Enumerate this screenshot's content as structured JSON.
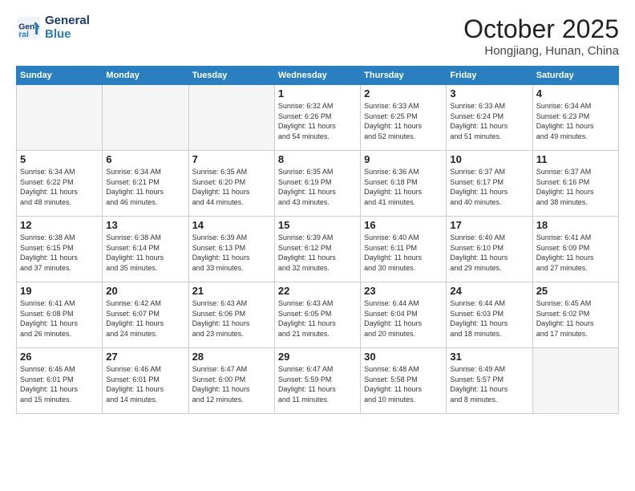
{
  "header": {
    "logo_line1": "General",
    "logo_line2": "Blue",
    "month": "October 2025",
    "location": "Hongjiang, Hunan, China"
  },
  "days_of_week": [
    "Sunday",
    "Monday",
    "Tuesday",
    "Wednesday",
    "Thursday",
    "Friday",
    "Saturday"
  ],
  "weeks": [
    [
      {
        "day": "",
        "info": ""
      },
      {
        "day": "",
        "info": ""
      },
      {
        "day": "",
        "info": ""
      },
      {
        "day": "1",
        "info": "Sunrise: 6:32 AM\nSunset: 6:26 PM\nDaylight: 11 hours\nand 54 minutes."
      },
      {
        "day": "2",
        "info": "Sunrise: 6:33 AM\nSunset: 6:25 PM\nDaylight: 11 hours\nand 52 minutes."
      },
      {
        "day": "3",
        "info": "Sunrise: 6:33 AM\nSunset: 6:24 PM\nDaylight: 11 hours\nand 51 minutes."
      },
      {
        "day": "4",
        "info": "Sunrise: 6:34 AM\nSunset: 6:23 PM\nDaylight: 11 hours\nand 49 minutes."
      }
    ],
    [
      {
        "day": "5",
        "info": "Sunrise: 6:34 AM\nSunset: 6:22 PM\nDaylight: 11 hours\nand 48 minutes."
      },
      {
        "day": "6",
        "info": "Sunrise: 6:34 AM\nSunset: 6:21 PM\nDaylight: 11 hours\nand 46 minutes."
      },
      {
        "day": "7",
        "info": "Sunrise: 6:35 AM\nSunset: 6:20 PM\nDaylight: 11 hours\nand 44 minutes."
      },
      {
        "day": "8",
        "info": "Sunrise: 6:35 AM\nSunset: 6:19 PM\nDaylight: 11 hours\nand 43 minutes."
      },
      {
        "day": "9",
        "info": "Sunrise: 6:36 AM\nSunset: 6:18 PM\nDaylight: 11 hours\nand 41 minutes."
      },
      {
        "day": "10",
        "info": "Sunrise: 6:37 AM\nSunset: 6:17 PM\nDaylight: 11 hours\nand 40 minutes."
      },
      {
        "day": "11",
        "info": "Sunrise: 6:37 AM\nSunset: 6:16 PM\nDaylight: 11 hours\nand 38 minutes."
      }
    ],
    [
      {
        "day": "12",
        "info": "Sunrise: 6:38 AM\nSunset: 6:15 PM\nDaylight: 11 hours\nand 37 minutes."
      },
      {
        "day": "13",
        "info": "Sunrise: 6:38 AM\nSunset: 6:14 PM\nDaylight: 11 hours\nand 35 minutes."
      },
      {
        "day": "14",
        "info": "Sunrise: 6:39 AM\nSunset: 6:13 PM\nDaylight: 11 hours\nand 33 minutes."
      },
      {
        "day": "15",
        "info": "Sunrise: 6:39 AM\nSunset: 6:12 PM\nDaylight: 11 hours\nand 32 minutes."
      },
      {
        "day": "16",
        "info": "Sunrise: 6:40 AM\nSunset: 6:11 PM\nDaylight: 11 hours\nand 30 minutes."
      },
      {
        "day": "17",
        "info": "Sunrise: 6:40 AM\nSunset: 6:10 PM\nDaylight: 11 hours\nand 29 minutes."
      },
      {
        "day": "18",
        "info": "Sunrise: 6:41 AM\nSunset: 6:09 PM\nDaylight: 11 hours\nand 27 minutes."
      }
    ],
    [
      {
        "day": "19",
        "info": "Sunrise: 6:41 AM\nSunset: 6:08 PM\nDaylight: 11 hours\nand 26 minutes."
      },
      {
        "day": "20",
        "info": "Sunrise: 6:42 AM\nSunset: 6:07 PM\nDaylight: 11 hours\nand 24 minutes."
      },
      {
        "day": "21",
        "info": "Sunrise: 6:43 AM\nSunset: 6:06 PM\nDaylight: 11 hours\nand 23 minutes."
      },
      {
        "day": "22",
        "info": "Sunrise: 6:43 AM\nSunset: 6:05 PM\nDaylight: 11 hours\nand 21 minutes."
      },
      {
        "day": "23",
        "info": "Sunrise: 6:44 AM\nSunset: 6:04 PM\nDaylight: 11 hours\nand 20 minutes."
      },
      {
        "day": "24",
        "info": "Sunrise: 6:44 AM\nSunset: 6:03 PM\nDaylight: 11 hours\nand 18 minutes."
      },
      {
        "day": "25",
        "info": "Sunrise: 6:45 AM\nSunset: 6:02 PM\nDaylight: 11 hours\nand 17 minutes."
      }
    ],
    [
      {
        "day": "26",
        "info": "Sunrise: 6:46 AM\nSunset: 6:01 PM\nDaylight: 11 hours\nand 15 minutes."
      },
      {
        "day": "27",
        "info": "Sunrise: 6:46 AM\nSunset: 6:01 PM\nDaylight: 11 hours\nand 14 minutes."
      },
      {
        "day": "28",
        "info": "Sunrise: 6:47 AM\nSunset: 6:00 PM\nDaylight: 11 hours\nand 12 minutes."
      },
      {
        "day": "29",
        "info": "Sunrise: 6:47 AM\nSunset: 5:59 PM\nDaylight: 11 hours\nand 11 minutes."
      },
      {
        "day": "30",
        "info": "Sunrise: 6:48 AM\nSunset: 5:58 PM\nDaylight: 11 hours\nand 10 minutes."
      },
      {
        "day": "31",
        "info": "Sunrise: 6:49 AM\nSunset: 5:57 PM\nDaylight: 11 hours\nand 8 minutes."
      },
      {
        "day": "",
        "info": ""
      }
    ]
  ]
}
